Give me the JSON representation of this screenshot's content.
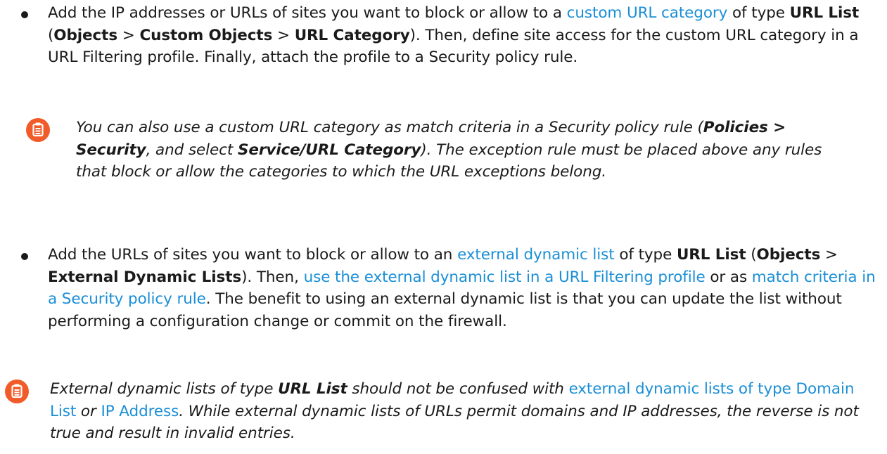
{
  "bullets": [
    {
      "p1": "Add the IP addresses or URLs of sites you want to block or allow to a ",
      "link1": "custom URL category",
      "p2": " of type ",
      "b1": "URL List",
      "p3": " (",
      "b2": "Objects",
      "p4": " > ",
      "b3": "Custom Objects",
      "p5": " > ",
      "b4": "URL Category",
      "p6": "). Then, define site access for the custom URL category in a URL Filtering profile. Finally, attach the profile to a Security policy rule."
    },
    {
      "p1": "Add the URLs of sites you want to block or allow to an ",
      "link1": "external dynamic list",
      "p2": " of type ",
      "b1": "URL List",
      "p3": " (",
      "b2": "Objects",
      "p4": " > ",
      "b3": "External Dynamic Lists",
      "p5": "). Then, ",
      "link2": "use the external dynamic list in a URL Filtering profile",
      "p6": " or as ",
      "link3": "match criteria in a Security policy rule",
      "p7": ". The benefit to using an external dynamic list is that you can update the list without performing a configuration change or commit on the firewall."
    }
  ],
  "notes": [
    {
      "icon": "note-icon",
      "p1": "You can also use a custom URL category as match criteria in a Security policy rule (",
      "b1": "Policies > Security",
      "p2": ", and select ",
      "b2": "Service/URL Category",
      "p3": "). The exception rule must be placed above any rules that block or allow the categories to which the URL exceptions belong."
    },
    {
      "icon": "note-icon",
      "p1": "External dynamic lists of type ",
      "b1": "URL List",
      "p2": " should not be confused with ",
      "link1": "external dynamic lists of type Domain List",
      "p3": " or ",
      "link2": "IP Address",
      "p4": ". While external dynamic lists of URLs permit domains and IP addresses, the reverse is not true and result in invalid entries."
    }
  ],
  "colors": {
    "link": "#1a8fd6",
    "note_icon": "#f15a29"
  }
}
